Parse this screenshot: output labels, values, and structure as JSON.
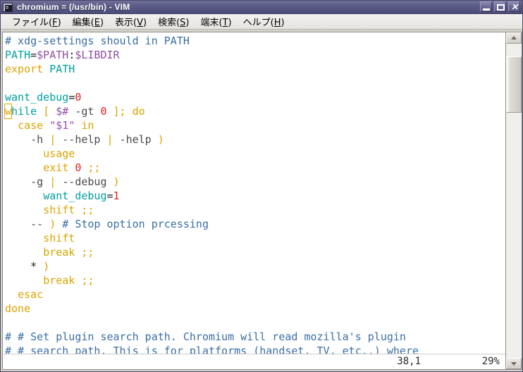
{
  "window": {
    "title": "chromium = (/usr/bin) - VIM",
    "icon": "terminal-icon",
    "controls": {
      "minimize_label": "–",
      "maximize_label": "□",
      "close_label": "✕"
    }
  },
  "menubar": {
    "items": [
      {
        "label_pre": "ファイル(",
        "accel": "F",
        "label_post": ")"
      },
      {
        "label_pre": "編集(",
        "accel": "E",
        "label_post": ")"
      },
      {
        "label_pre": "表示(",
        "accel": "V",
        "label_post": ")"
      },
      {
        "label_pre": "検索(",
        "accel": "S",
        "label_post": ")"
      },
      {
        "label_pre": "端末(",
        "accel": "T",
        "label_post": ")"
      },
      {
        "label_pre": "ヘルプ(",
        "accel": "H",
        "label_post": ")"
      }
    ]
  },
  "editor": {
    "filetype": "sh",
    "cursor_char": "w",
    "lines": [
      "# xdg-settings should in PATH",
      "PATH=$PATH:$LIBDIR",
      "export PATH",
      "",
      "want_debug=0",
      "while [ $# -gt 0 ]; do",
      "  case \"$1\" in",
      "    -h | --help | -help )",
      "      usage",
      "      exit 0 ;;",
      "    -g | --debug )",
      "      want_debug=1",
      "      shift ;;",
      "    -- ) # Stop option prcessing",
      "      shift",
      "      break ;;",
      "    * )",
      "      break ;;",
      "  esac",
      "done",
      "",
      "# # Set plugin search path. Chromium will read mozilla's plugin",
      "# # search path. This is for platforms (handset, TV, etc..) where"
    ]
  },
  "statusline": {
    "ruler": "38,1",
    "percent": "29%"
  },
  "scrollbar": {
    "up_icon": "chevron-up-icon",
    "down_icon": "chevron-down-icon",
    "thumb_position_percent": 4,
    "thumb_size_percent": 18
  },
  "colors": {
    "titlebar": "#5a5a86",
    "comment": "#3a6ea5",
    "identifier": "#00a0a0",
    "variable": "#8f4f9e",
    "keyword": "#d9a400",
    "number": "#e02020",
    "string": "#9a4fb0",
    "cursor": "#d9a400",
    "editor_bg": "#ffffff",
    "frame_bg": "#d6d2cc"
  }
}
